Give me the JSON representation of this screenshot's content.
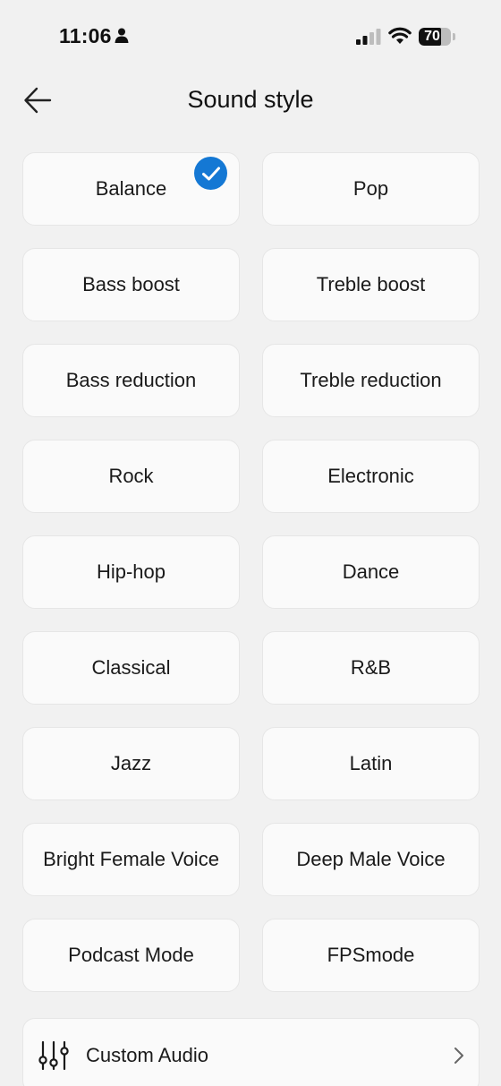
{
  "status_bar": {
    "time": "11:06",
    "battery_level": "70",
    "battery_fraction": 0.7,
    "signal_bars_active": 2,
    "signal_bars_total": 4
  },
  "header": {
    "title": "Sound style",
    "back_icon": "arrow-left-icon"
  },
  "styles": [
    {
      "label": "Balance",
      "selected": true
    },
    {
      "label": "Pop",
      "selected": false
    },
    {
      "label": "Bass boost",
      "selected": false
    },
    {
      "label": "Treble boost",
      "selected": false
    },
    {
      "label": "Bass reduction",
      "selected": false
    },
    {
      "label": "Treble reduction",
      "selected": false
    },
    {
      "label": "Rock",
      "selected": false
    },
    {
      "label": "Electronic",
      "selected": false
    },
    {
      "label": "Hip-hop",
      "selected": false
    },
    {
      "label": "Dance",
      "selected": false
    },
    {
      "label": "Classical",
      "selected": false
    },
    {
      "label": "R&B",
      "selected": false
    },
    {
      "label": "Jazz",
      "selected": false
    },
    {
      "label": "Latin",
      "selected": false
    },
    {
      "label": "Bright Female Voice",
      "selected": false
    },
    {
      "label": "Deep Male Voice",
      "selected": false
    },
    {
      "label": "Podcast Mode",
      "selected": false
    },
    {
      "label": "FPSmode",
      "selected": false
    }
  ],
  "custom_audio": {
    "label": "Custom Audio",
    "icon": "equalizer-icon",
    "trailing_icon": "chevron-right-icon"
  },
  "colors": {
    "accent": "#1478d4",
    "background": "#f1f1f1",
    "card": "#fafafa"
  }
}
